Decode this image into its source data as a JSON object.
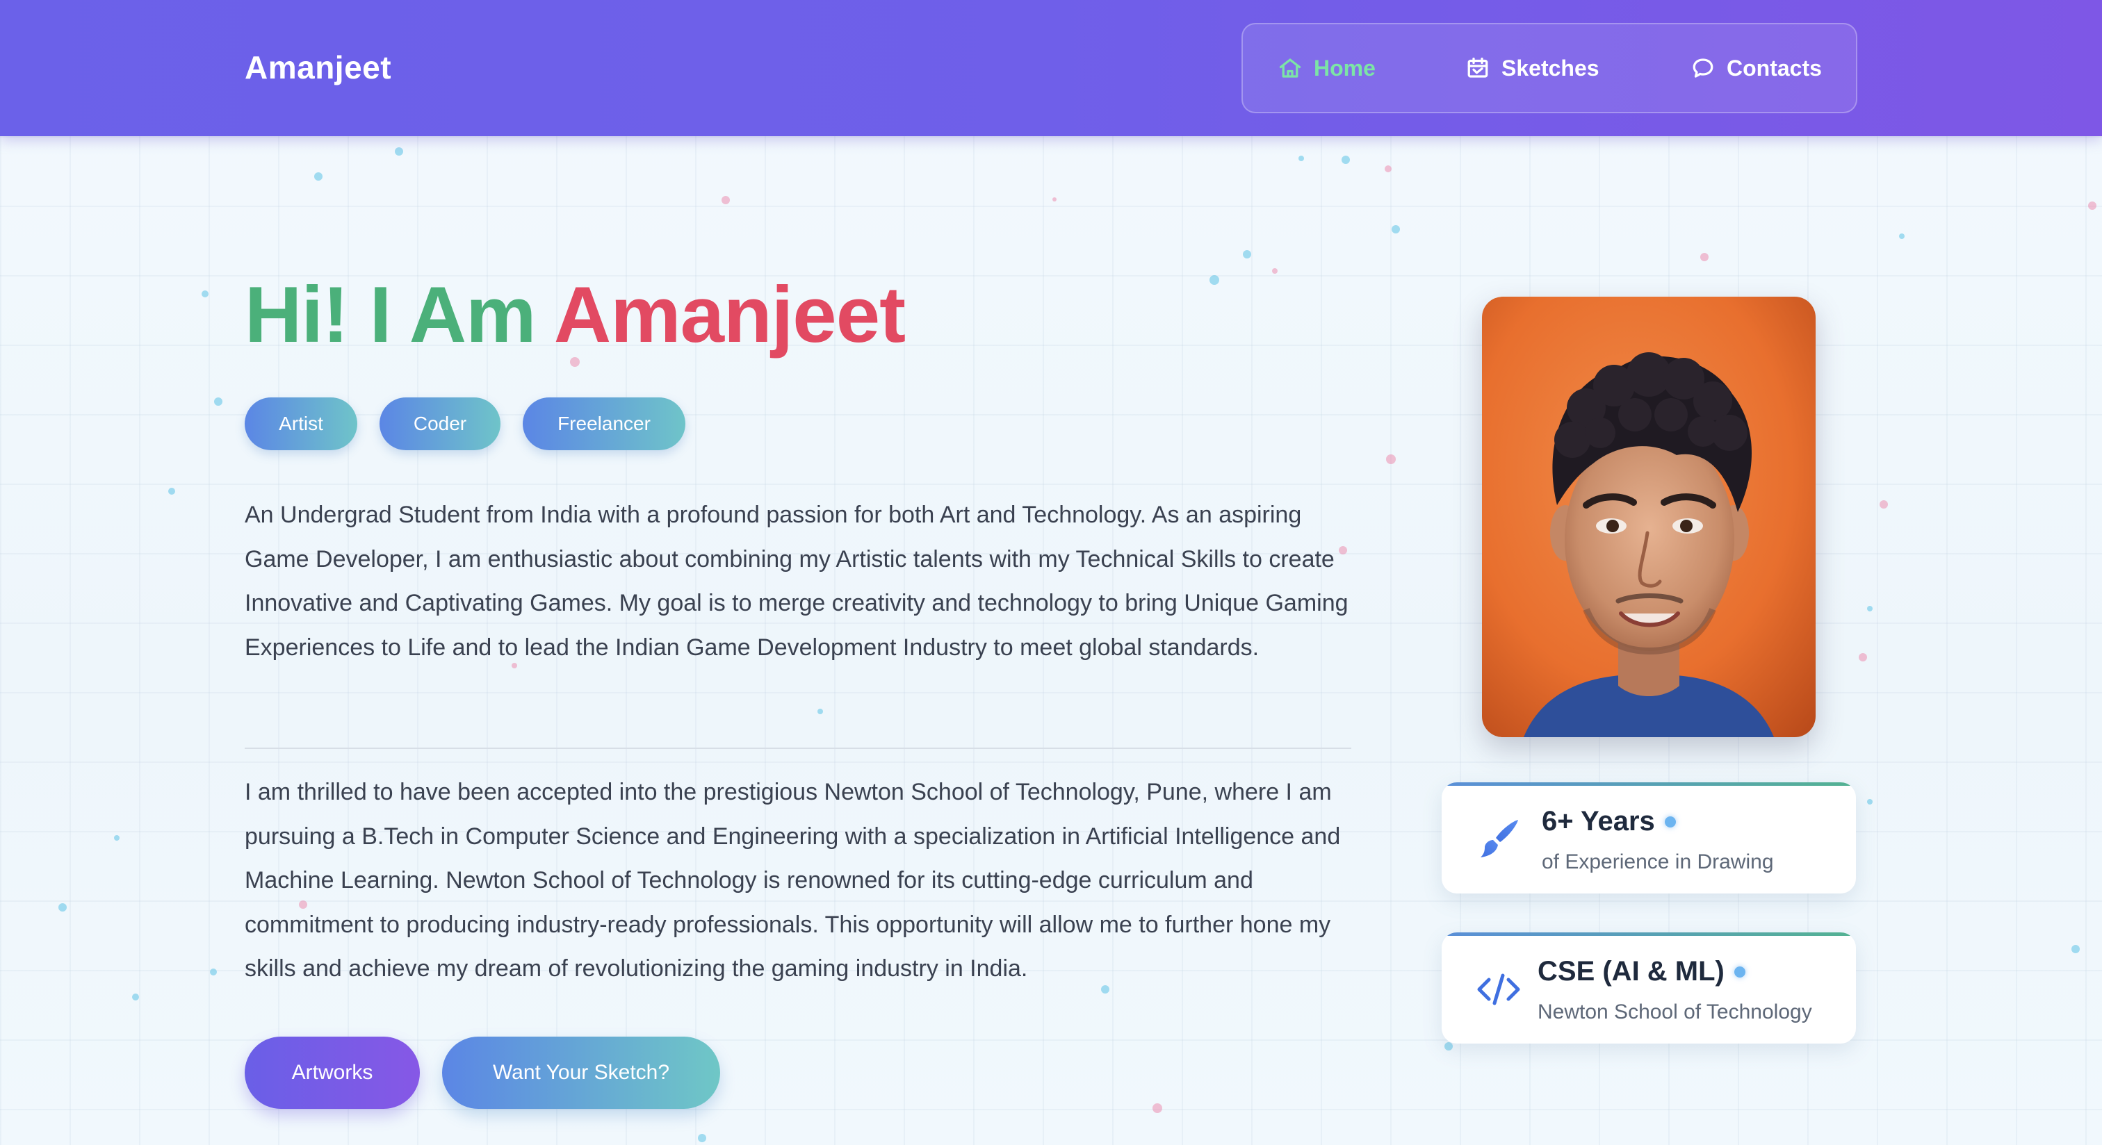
{
  "brand": "Amanjeet",
  "nav": {
    "items": [
      {
        "label": "Home",
        "icon": "home-icon",
        "active": true
      },
      {
        "label": "Sketches",
        "icon": "calendar-sketch-icon",
        "active": false
      },
      {
        "label": "Contacts",
        "icon": "chat-bubble-icon",
        "active": false
      }
    ]
  },
  "hero": {
    "greeting": "Hi! I Am",
    "name": "Amanjeet",
    "tags": [
      "Artist",
      "Coder",
      "Freelancer"
    ],
    "paragraph1": "An Undergrad Student from India with a profound passion for both Art and Technology. As an aspiring Game Developer, I am enthusiastic about combining my Artistic talents with my Technical Skills to create Innovative and Captivating Games. My goal is to merge creativity and technology to bring Unique Gaming Experiences to Life and to lead the Indian Game Development Industry to meet global standards.",
    "paragraph2": "I am thrilled to have been accepted into the prestigious Newton School of Technology, Pune, where I am pursuing a B.Tech in Computer Science and Engineering with a specialization in Artificial Intelligence and Machine Learning. Newton School of Technology is renowned for its cutting-edge curriculum and commitment to producing industry-ready professionals. This opportunity will allow me to further hone my skills and achieve my dream of revolutionizing the gaming industry in India.",
    "buttons": {
      "primary": "Artworks",
      "secondary": "Want Your Sketch?"
    }
  },
  "cards": [
    {
      "title": "6+ Years",
      "subtitle": "of Experience in Drawing",
      "icon": "paintbrush-icon"
    },
    {
      "title": "CSE (AI & ML)",
      "subtitle": "Newton School of Technology",
      "icon": "code-icon"
    }
  ],
  "colors": {
    "header_start": "#6b61e9",
    "header_end": "#7e57e6",
    "nav_active": "#7ce4a6",
    "greeting": "#4bb07a",
    "name": "#e24a62",
    "text": "#3a4150"
  }
}
